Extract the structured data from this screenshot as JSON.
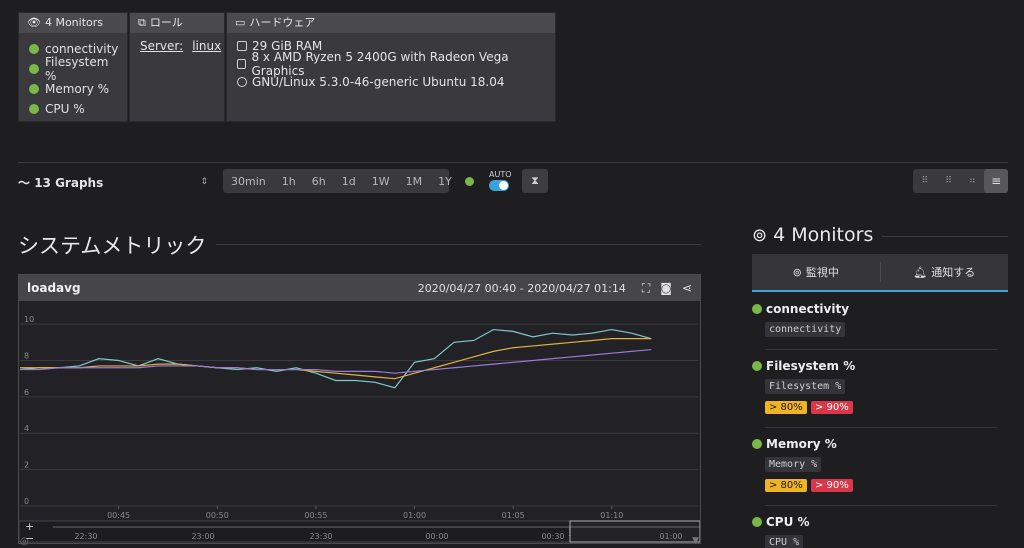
{
  "summary": {
    "monitors": {
      "title": "4 Monitors",
      "items": [
        "connectivity",
        "Filesystem %",
        "Memory %",
        "CPU %"
      ]
    },
    "role": {
      "title": "ロール",
      "server_label": "Server:",
      "server_value": "linux"
    },
    "hardware": {
      "title": "ハードウェア",
      "ram": "29 GiB RAM",
      "cpu": "8 x AMD Ryzen 5 2400G with Radeon Vega Graphics",
      "os": "GNU/Linux 5.3.0-46-generic Ubuntu 18.04"
    }
  },
  "toolbar": {
    "graphs_label": "13 Graphs",
    "ranges": [
      "30min",
      "1h",
      "6h",
      "1d",
      "1W",
      "1M",
      "1Y"
    ],
    "auto_label": "AUTO"
  },
  "section_title": "システムメトリック",
  "chart": {
    "name": "loadavg",
    "range": "2020/04/27 00:40 - 2020/04/27 01:14"
  },
  "chart_data": {
    "type": "line",
    "x": [
      "00:40",
      "00:41",
      "00:42",
      "00:43",
      "00:44",
      "00:45",
      "00:46",
      "00:47",
      "00:48",
      "00:49",
      "00:50",
      "00:51",
      "00:52",
      "00:53",
      "00:54",
      "00:55",
      "00:56",
      "00:57",
      "00:58",
      "00:59",
      "01:00",
      "01:01",
      "01:02",
      "01:03",
      "01:04",
      "01:05",
      "01:06",
      "01:07",
      "01:08",
      "01:09",
      "01:10",
      "01:11",
      "01:12",
      "01:13"
    ],
    "xticks": [
      "00:45",
      "00:50",
      "00:55",
      "01:00",
      "01:05",
      "01:10"
    ],
    "yticks": [
      "0",
      "2",
      "4",
      "6",
      "8",
      "10"
    ],
    "ylim": [
      0,
      10.5
    ],
    "series": [
      {
        "color": "#7ec8c8",
        "values": [
          7.5,
          7.6,
          7.6,
          7.7,
          8.1,
          8.0,
          7.7,
          8.1,
          7.8,
          7.7,
          7.6,
          7.5,
          7.6,
          7.4,
          7.6,
          7.3,
          6.9,
          6.9,
          6.8,
          6.5,
          7.9,
          8.1,
          9.0,
          9.1,
          9.7,
          9.6,
          9.3,
          9.5,
          9.4,
          9.5,
          9.7,
          9.5,
          9.2
        ]
      },
      {
        "color": "#e0b040",
        "values": [
          7.6,
          7.6,
          7.6,
          7.6,
          7.7,
          7.7,
          7.7,
          7.8,
          7.8,
          7.7,
          7.6,
          7.6,
          7.5,
          7.5,
          7.5,
          7.4,
          7.3,
          7.2,
          7.1,
          7.0,
          7.3,
          7.6,
          7.9,
          8.2,
          8.5,
          8.7,
          8.8,
          8.9,
          9.0,
          9.1,
          9.2,
          9.2,
          9.2
        ]
      },
      {
        "color": "#9a7ad8",
        "values": [
          7.5,
          7.5,
          7.6,
          7.6,
          7.6,
          7.6,
          7.6,
          7.7,
          7.7,
          7.7,
          7.6,
          7.6,
          7.5,
          7.5,
          7.5,
          7.5,
          7.4,
          7.4,
          7.4,
          7.3,
          7.4,
          7.5,
          7.6,
          7.7,
          7.8,
          7.9,
          8.0,
          8.1,
          8.2,
          8.3,
          8.4,
          8.5,
          8.6
        ]
      }
    ],
    "navigator_ticks": [
      "22:30",
      "23:00",
      "23:30",
      "00:00",
      "00:30",
      "01:00"
    ]
  },
  "right": {
    "title": "4 Monitors",
    "tab_watch": "監視中",
    "tab_notify": "通知する",
    "monitors": [
      {
        "name": "connectivity",
        "code": "connectivity",
        "warn": "",
        "crit": ""
      },
      {
        "name": "Filesystem %",
        "code": "Filesystem %",
        "warn": "> 80%",
        "crit": "> 90%"
      },
      {
        "name": "Memory %",
        "code": "Memory %",
        "warn": "> 80%",
        "crit": "> 90%"
      },
      {
        "name": "CPU %",
        "code": "CPU %",
        "warn": "",
        "crit": ""
      }
    ]
  },
  "colors": {
    "ok": "#7ab648",
    "accent": "#3ba3d9",
    "warn": "#f0b324",
    "crit": "#d9384a"
  }
}
